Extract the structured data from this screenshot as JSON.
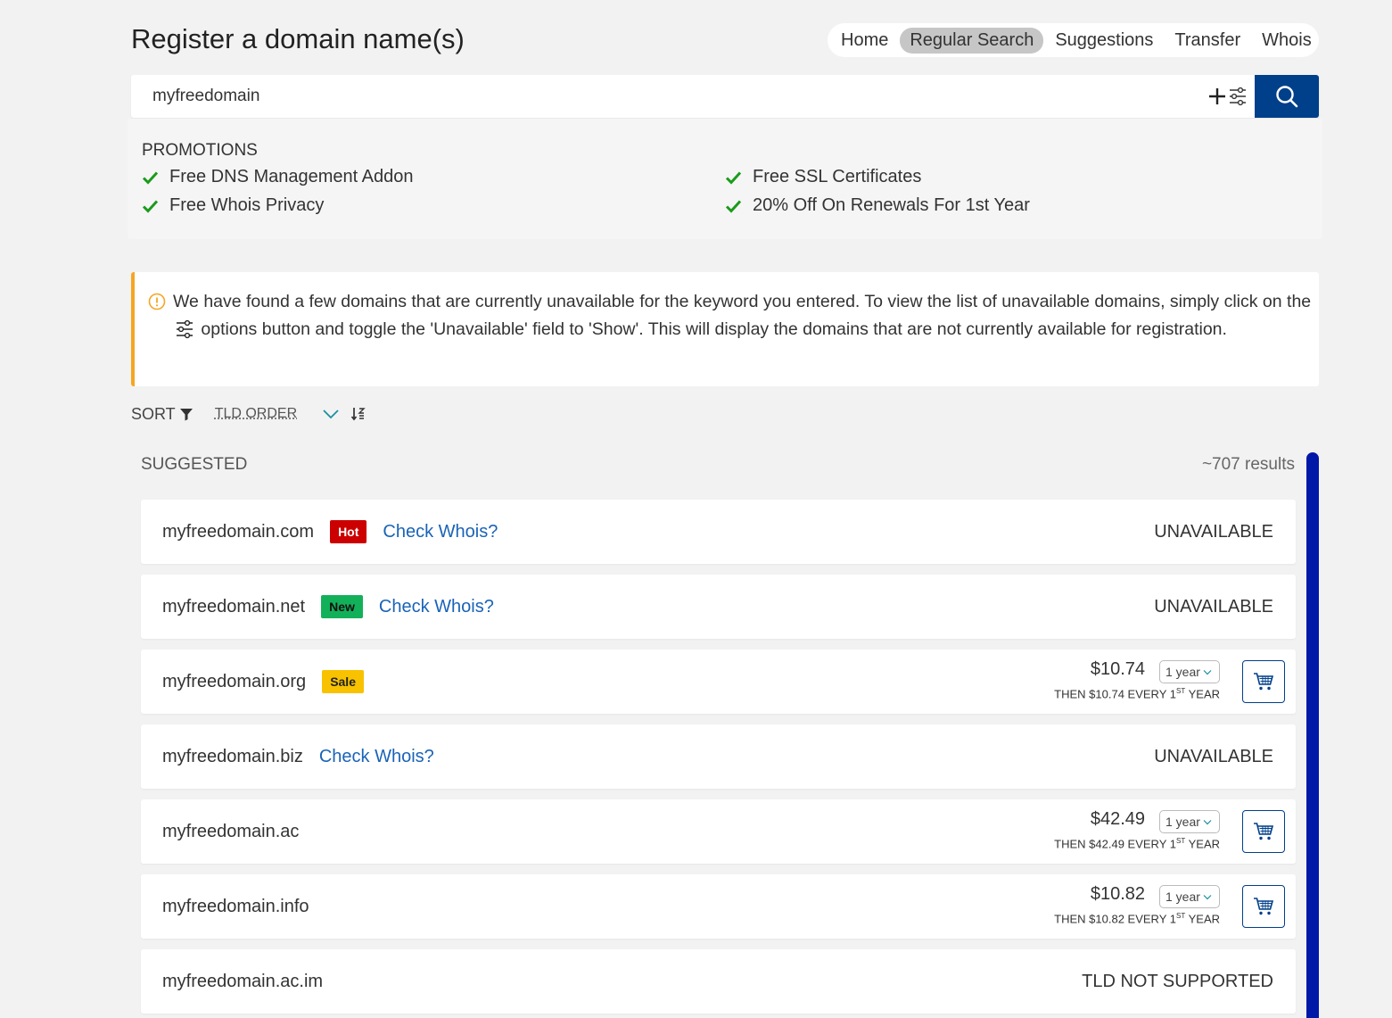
{
  "page": {
    "title": "Register a domain name(s)"
  },
  "nav": {
    "items": [
      {
        "label": "Home",
        "active": false
      },
      {
        "label": "Regular Search",
        "active": true
      },
      {
        "label": "Suggestions",
        "active": false
      },
      {
        "label": "Transfer",
        "active": false
      },
      {
        "label": "Whois",
        "active": false
      }
    ]
  },
  "search": {
    "value": "myfreedomain",
    "options_icon": "plus-sliders-icon",
    "button_icon": "search-icon"
  },
  "promotions": {
    "title": "PROMOTIONS",
    "items": [
      "Free DNS Management Addon",
      "Free Whois Privacy",
      "Free SSL Certificates",
      "20% Off On Renewals For 1st Year"
    ]
  },
  "alert": {
    "text_before": "We have found a few domains that are currently unavailable for the keyword you entered. To view the list of unavailable domains, simply click on the",
    "text_after": "options button and toggle the 'Unavailable' field to 'Show'. This will display the domains that are not currently available for registration."
  },
  "sort": {
    "label": "SORT",
    "value": "TLD ORDER"
  },
  "results": {
    "section_label": "SUGGESTED",
    "count": "~707 results",
    "rows": [
      {
        "domain": "myfreedomain.com",
        "badge": "Hot",
        "whois": "Check Whois?",
        "status": "UNAVAILABLE"
      },
      {
        "domain": "myfreedomain.net",
        "badge": "New",
        "whois": "Check Whois?",
        "status": "UNAVAILABLE"
      },
      {
        "domain": "myfreedomain.org",
        "badge": "Sale",
        "price": "$10.74",
        "term": "1 year",
        "renew_prefix": "THEN $10.74 EVERY 1",
        "renew_sup": "ST",
        "renew_suffix": " YEAR"
      },
      {
        "domain": "myfreedomain.biz",
        "whois": "Check Whois?",
        "status": "UNAVAILABLE"
      },
      {
        "domain": "myfreedomain.ac",
        "price": "$42.49",
        "term": "1 year",
        "renew_prefix": "THEN $42.49 EVERY 1",
        "renew_sup": "ST",
        "renew_suffix": " YEAR"
      },
      {
        "domain": "myfreedomain.info",
        "price": "$10.82",
        "term": "1 year",
        "renew_prefix": "THEN $10.82 EVERY 1",
        "renew_sup": "ST",
        "renew_suffix": " YEAR"
      },
      {
        "domain": "myfreedomain.ac.im",
        "status": "TLD NOT SUPPORTED"
      }
    ]
  },
  "colors": {
    "accent": "#003f8a",
    "hot": "#cc0000",
    "new": "#13b05a",
    "sale": "#f8c200",
    "check": "#1a9b1a",
    "link": "#1a63b7",
    "warning": "#f5a623"
  }
}
